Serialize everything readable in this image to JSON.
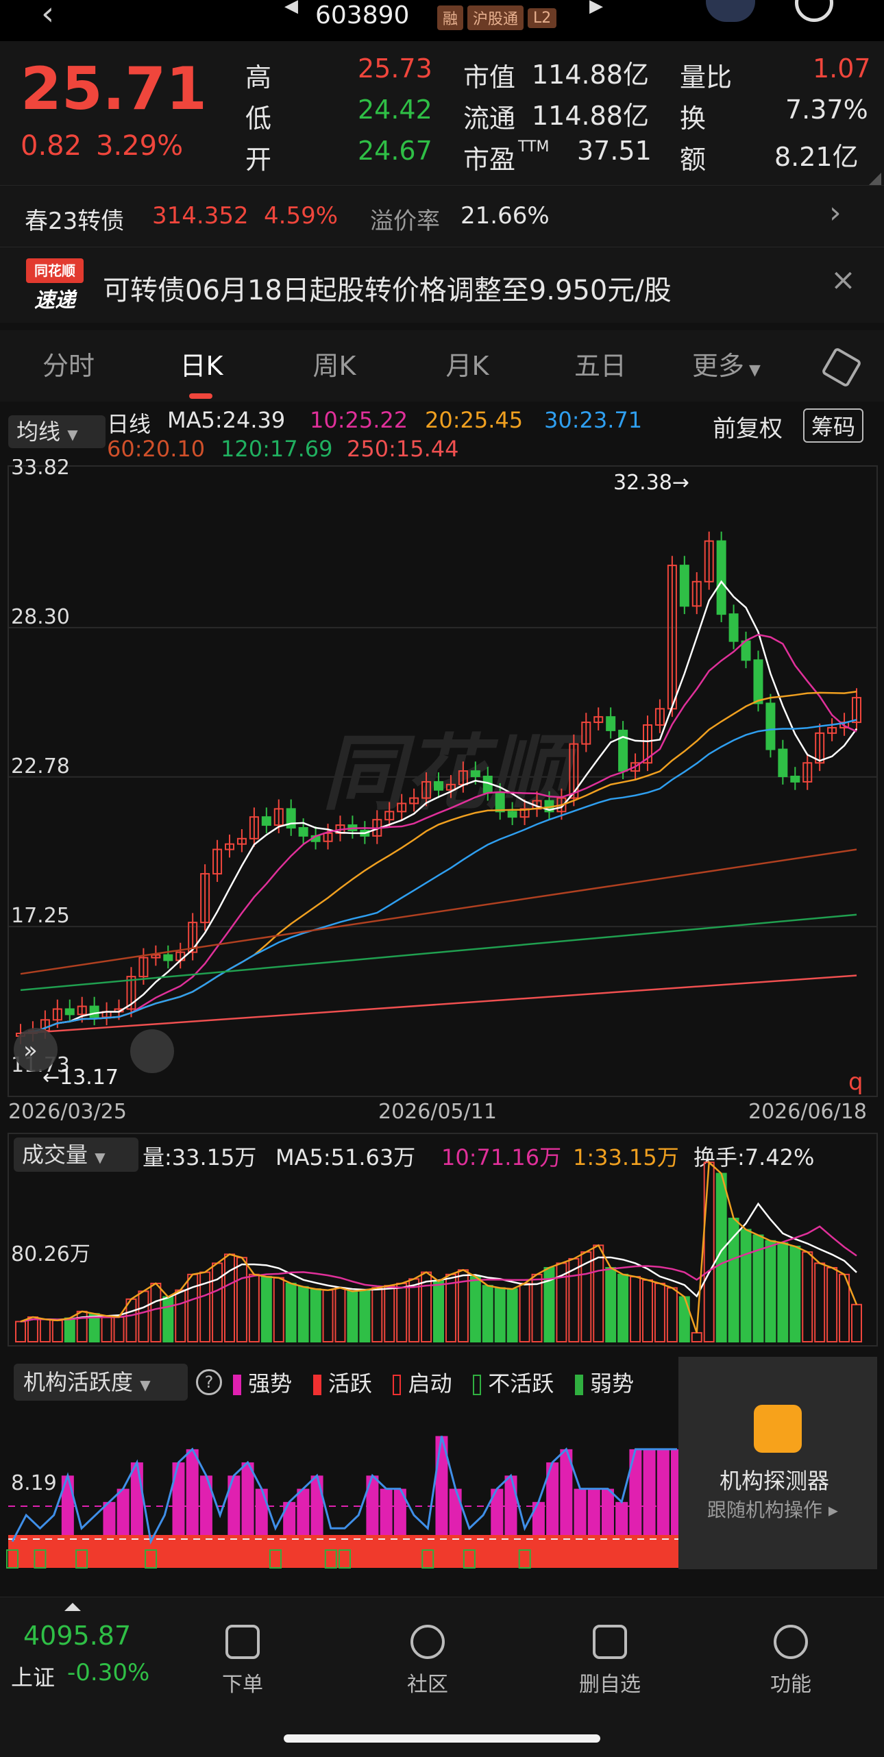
{
  "header": {
    "code": "603890",
    "badges": [
      "融",
      "沪股通",
      "L2"
    ]
  },
  "quote": {
    "price": "25.71",
    "change": "0.82",
    "change_pct": "3.29%",
    "high_label": "高",
    "high": "25.73",
    "low_label": "低",
    "low": "24.42",
    "open_label": "开",
    "open": "24.67",
    "mktcap_label": "市值",
    "mktcap": "114.88亿",
    "float_label": "流通",
    "float": "114.88亿",
    "pe_label": "市盈",
    "pe_sup": "TTM",
    "pe": "37.51",
    "volratio_label": "量比",
    "volratio": "1.07",
    "turnover_label": "换",
    "turnover": "7.37%",
    "amount_label": "额",
    "amount": "8.21亿"
  },
  "convertible": {
    "name": "春23转债",
    "price": "314.352",
    "change_pct": "4.59%",
    "premium_label": "溢价率",
    "premium": "21.66%"
  },
  "notice": {
    "logo_top": "同花顺",
    "logo_bottom": "速递",
    "text": "可转债06月18日起股转价格调整至9.950元/股"
  },
  "tabs": [
    {
      "label": "分时"
    },
    {
      "label": "日K"
    },
    {
      "label": "周K"
    },
    {
      "label": "月K"
    },
    {
      "label": "五日"
    },
    {
      "label": "更多"
    }
  ],
  "kchart": {
    "ma_selector": "均线",
    "period": "日线",
    "ma5": "MA5:24.39",
    "ma10": "10:25.22",
    "ma20": "20:25.45",
    "ma30": "30:23.71",
    "ma60": "60:20.10",
    "ma120": "120:17.69",
    "ma250": "250:15.44",
    "adjust": "前复权",
    "chips": "筹码",
    "y_labels": [
      "33.82",
      "28.30",
      "22.78",
      "17.25",
      "11.73"
    ],
    "max_label": "32.38→",
    "min_label": "←13.17",
    "x_labels": [
      "2026/03/25",
      "2026/05/11",
      "2026/06/18"
    ],
    "watermark": "同花顺"
  },
  "volume": {
    "selector": "成交量",
    "vol": "量:33.15万",
    "ma5": "MA5:51.63万",
    "ma10": "10:71.16万",
    "ma1": "1:33.15万",
    "turnover": "换手:7.42%",
    "y_label": "80.26万"
  },
  "activity": {
    "selector": "机构活跃度",
    "legend": [
      {
        "label": "强势",
        "color": "#e020b0"
      },
      {
        "label": "活跃",
        "color": "#f03030"
      },
      {
        "label": "启动",
        "color": "#f03030"
      },
      {
        "label": "不活跃",
        "color": "#30b040"
      },
      {
        "label": "弱势",
        "color": "#30b040"
      }
    ],
    "y_label": "8.19",
    "promo_title": "机构探测器",
    "promo_sub": "跟随机构操作"
  },
  "bottom": {
    "index_value": "4095.87",
    "index_name": "上证",
    "index_change": "-0.30%",
    "nav": [
      {
        "label": "下单"
      },
      {
        "label": "社区"
      },
      {
        "label": "删自选"
      },
      {
        "label": "功能"
      }
    ]
  },
  "chart_data": {
    "type": "candlestick",
    "x_range": [
      "2026/03/25",
      "2026/06/18"
    ],
    "ylim": [
      11.73,
      33.82
    ],
    "closes": [
      13.3,
      13.4,
      13.8,
      14.2,
      14.0,
      14.3,
      13.9,
      14.1,
      14.2,
      15.4,
      16.1,
      16.2,
      16.0,
      16.3,
      17.4,
      19.2,
      20.1,
      20.3,
      20.5,
      21.3,
      21.0,
      21.6,
      20.9,
      20.6,
      20.4,
      20.7,
      21.0,
      20.8,
      20.6,
      21.2,
      21.5,
      21.8,
      22.0,
      22.6,
      22.3,
      22.5,
      23.0,
      22.8,
      22.2,
      21.5,
      21.3,
      21.6,
      21.9,
      21.5,
      22.0,
      24.0,
      24.8,
      25.0,
      24.5,
      23.0,
      23.3,
      24.7,
      25.3,
      30.6,
      29.1,
      30.0,
      31.5,
      28.8,
      27.8,
      27.1,
      25.5,
      23.8,
      22.8,
      22.6,
      23.3,
      24.4,
      24.6,
      24.8,
      25.71
    ],
    "ma_series": [
      {
        "name": "MA5",
        "color": "#ffffff"
      },
      {
        "name": "10",
        "color": "#e0309a"
      },
      {
        "name": "20",
        "color": "#f0a020"
      },
      {
        "name": "30",
        "color": "#2f9ff0"
      },
      {
        "name": "60",
        "color": "#b04020"
      },
      {
        "name": "120",
        "color": "#20a050"
      },
      {
        "name": "250",
        "color": "#f05050"
      }
    ],
    "volume_values": [
      18,
      22,
      20,
      19,
      21,
      27,
      25,
      23,
      22,
      38,
      45,
      52,
      40,
      46,
      60,
      62,
      70,
      78,
      75,
      60,
      58,
      57,
      52,
      49,
      47,
      46,
      48,
      45,
      46,
      48,
      50,
      52,
      56,
      62,
      54,
      60,
      64,
      58,
      50,
      48,
      47,
      52,
      60,
      66,
      70,
      74,
      80,
      86,
      66,
      60,
      58,
      55,
      52,
      48,
      40,
      8,
      160,
      150,
      110,
      100,
      95,
      90,
      88,
      85,
      80,
      70,
      66,
      60,
      33.15
    ],
    "activity_values": [
      2,
      4,
      3,
      4,
      7,
      3,
      4,
      5,
      6,
      8,
      2,
      4,
      8,
      9,
      7,
      4,
      7,
      8,
      6,
      3,
      5,
      6,
      7,
      3,
      3,
      4,
      7,
      6,
      6,
      4,
      3,
      10,
      6,
      3,
      4,
      6,
      7,
      3,
      5,
      8,
      9,
      6,
      6,
      6,
      5,
      9,
      9,
      9,
      9
    ]
  }
}
